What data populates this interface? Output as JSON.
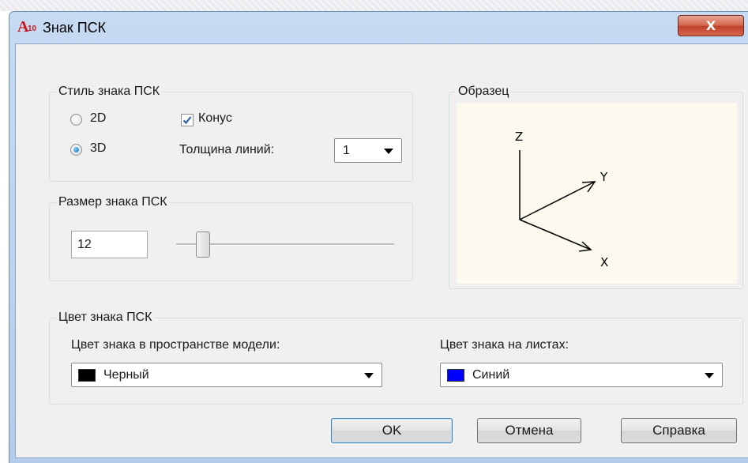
{
  "window": {
    "title": "Знак ПСК",
    "icon": "autocad-icon",
    "icon_text": "A",
    "icon_subtext": "10",
    "close_glyph": "X"
  },
  "style_group": {
    "title": "Стиль знака ПСК",
    "radio_2d": {
      "label": "2D",
      "selected": false
    },
    "radio_3d": {
      "label": "3D",
      "selected": true
    },
    "cone": {
      "label": "Конус",
      "checked": true
    },
    "line_width_label": "Толщина линий:",
    "line_width_value": "1"
  },
  "size_group": {
    "title": "Размер знака ПСК",
    "value": "12",
    "slider_position": 0.12
  },
  "preview_group": {
    "title": "Образец",
    "axes": {
      "z": "Z",
      "y": "Y",
      "x": "X"
    }
  },
  "color_group": {
    "title": "Цвет знака ПСК",
    "model_label": "Цвет знака в пространстве модели:",
    "model_value": "Черный",
    "model_color": "#000000",
    "layout_label": "Цвет знака на листах:",
    "layout_value": "Синий",
    "layout_color": "#0000ff"
  },
  "buttons": {
    "ok": "OK",
    "cancel": "Отмена",
    "help": "Справка"
  }
}
